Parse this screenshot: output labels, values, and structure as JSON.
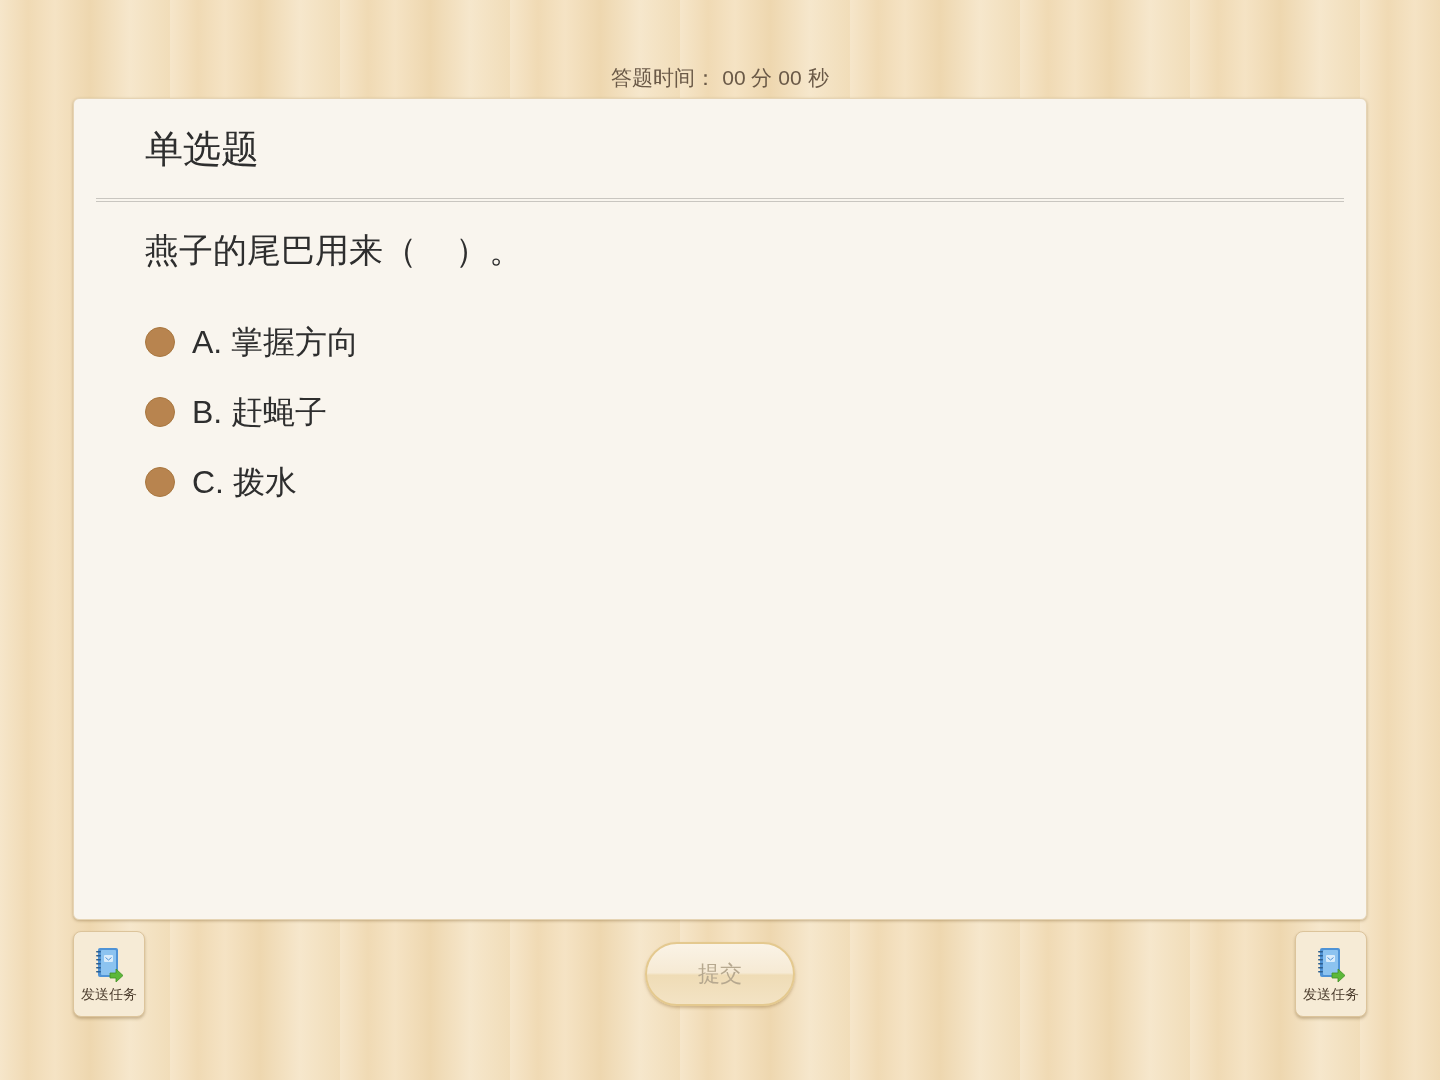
{
  "timer": "答题时间： 00 分 00 秒",
  "question": {
    "type_label": "单选题",
    "text": "燕子的尾巴用来（    ）。",
    "options": [
      {
        "label": "A. 掌握方向",
        "selected": false
      },
      {
        "label": "B. 赶蝇子",
        "selected": false
      },
      {
        "label": "C. 拨水",
        "selected": false
      }
    ]
  },
  "bottom_bar": {
    "left_button": {
      "label": "发送任务"
    },
    "submit_button": {
      "label": "提交",
      "disabled": true
    },
    "right_button": {
      "label": "发送任务"
    }
  }
}
